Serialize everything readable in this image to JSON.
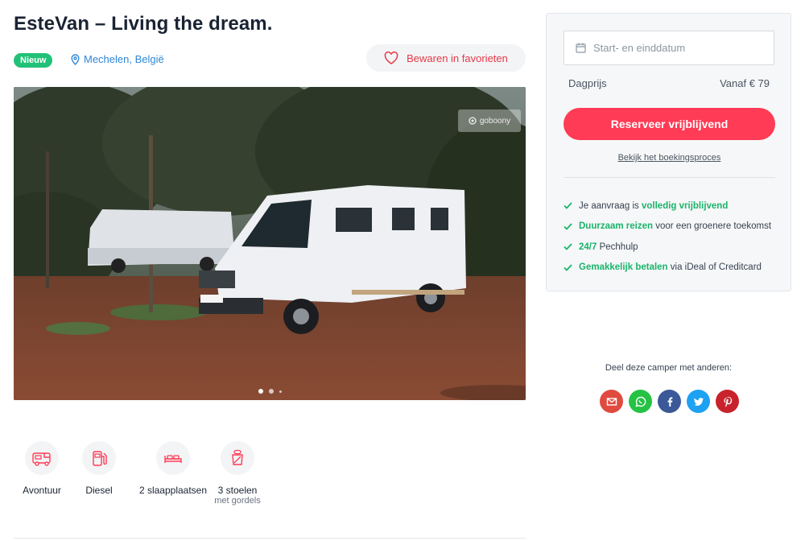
{
  "listing": {
    "title": "EsteVan – Living the dream.",
    "badge": "Nieuw",
    "location": "Mechelen, België",
    "favorite_label": "Bewaren in favorieten",
    "watermark": "goboony"
  },
  "gallery": {
    "slide_count": 3,
    "active_slide": 1
  },
  "features": [
    {
      "icon": "campervan-icon",
      "label": "Avontuur",
      "sub": ""
    },
    {
      "icon": "fuel-pump-icon",
      "label": "Diesel",
      "sub": ""
    },
    {
      "icon": "bed-icon",
      "label": "2 slaapplaatsen",
      "sub": ""
    },
    {
      "icon": "seat-icon",
      "label": "3 stoelen",
      "sub": "met gordels"
    }
  ],
  "booking": {
    "date_placeholder": "Start- en einddatum",
    "price_label": "Dagprijs",
    "price_value": "Vanaf € 79",
    "reserve_label": "Reserveer vrijblijvend",
    "process_link": "Bekijk het boekingsproces",
    "usps": [
      {
        "pre": "Je aanvraag is ",
        "highlight": "volledig vrijblijvend",
        "post": ""
      },
      {
        "pre": "",
        "highlight": "Duurzaam reizen",
        "post": " voor een groenere toekomst"
      },
      {
        "pre": "",
        "highlight": "24/7",
        "post": " Pechhulp"
      },
      {
        "pre": "",
        "highlight": "Gemakkelijk betalen",
        "post": " via iDeal of Creditcard"
      }
    ]
  },
  "share": {
    "title": "Deel deze camper met anderen:",
    "buttons": [
      {
        "name": "email",
        "color": "#e04a3f"
      },
      {
        "name": "whatsapp",
        "color": "#25c244"
      },
      {
        "name": "facebook",
        "color": "#3b5998"
      },
      {
        "name": "twitter",
        "color": "#1da1f2"
      },
      {
        "name": "pinterest",
        "color": "#c8232c"
      }
    ]
  },
  "colors": {
    "accent": "#ff3b55",
    "success": "#19b46a",
    "link": "#2f86d6"
  }
}
